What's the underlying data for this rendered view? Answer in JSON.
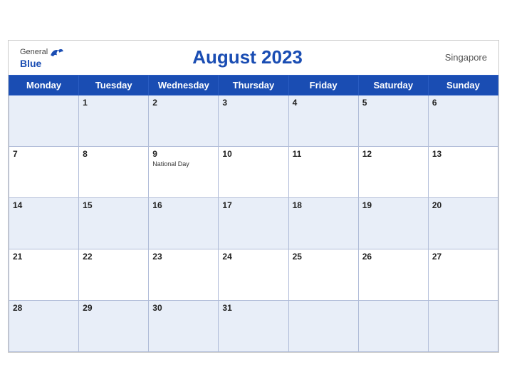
{
  "header": {
    "logo_general": "General",
    "logo_blue": "Blue",
    "title": "August 2023",
    "region": "Singapore"
  },
  "weekdays": [
    "Monday",
    "Tuesday",
    "Wednesday",
    "Thursday",
    "Friday",
    "Saturday",
    "Sunday"
  ],
  "weeks": [
    [
      {
        "day": "",
        "empty": true
      },
      {
        "day": "1"
      },
      {
        "day": "2"
      },
      {
        "day": "3"
      },
      {
        "day": "4"
      },
      {
        "day": "5"
      },
      {
        "day": "6"
      }
    ],
    [
      {
        "day": "7"
      },
      {
        "day": "8"
      },
      {
        "day": "9",
        "event": "National Day"
      },
      {
        "day": "10"
      },
      {
        "day": "11"
      },
      {
        "day": "12"
      },
      {
        "day": "13"
      }
    ],
    [
      {
        "day": "14"
      },
      {
        "day": "15"
      },
      {
        "day": "16"
      },
      {
        "day": "17"
      },
      {
        "day": "18"
      },
      {
        "day": "19"
      },
      {
        "day": "20"
      }
    ],
    [
      {
        "day": "21"
      },
      {
        "day": "22"
      },
      {
        "day": "23"
      },
      {
        "day": "24"
      },
      {
        "day": "25"
      },
      {
        "day": "26"
      },
      {
        "day": "27"
      }
    ],
    [
      {
        "day": "28"
      },
      {
        "day": "29"
      },
      {
        "day": "30"
      },
      {
        "day": "31"
      },
      {
        "day": "",
        "empty": true
      },
      {
        "day": "",
        "empty": true
      },
      {
        "day": "",
        "empty": true
      }
    ]
  ],
  "colors": {
    "header_bg": "#1a4db3",
    "odd_row_bg": "#e8eef8",
    "even_row_bg": "#ffffff"
  }
}
